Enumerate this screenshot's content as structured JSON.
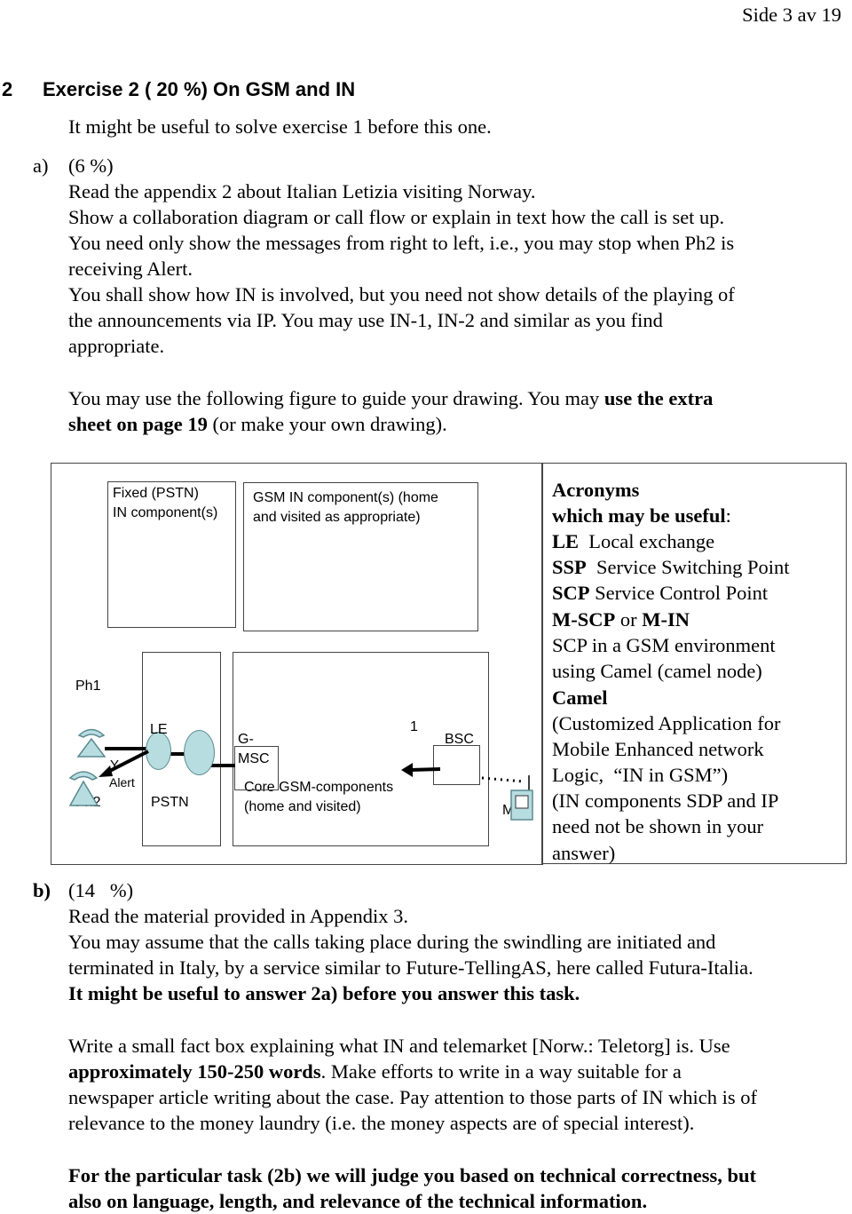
{
  "header": {
    "page": "Side 3 av 19"
  },
  "section": {
    "number": "2",
    "title": "Exercise 2 ( 20 %) On GSM and IN"
  },
  "intro": "It might be useful to solve exercise 1 before this one.",
  "a": {
    "label": "a)",
    "weight": "(6 %)",
    "lines": [
      "Read the appendix 2 about Italian Letizia visiting Norway.",
      "Show a collaboration diagram or call flow or explain in text how the call is set up.",
      "You need only show the messages from right to left, i.e., you may stop when Ph2 is",
      "receiving Alert.",
      "You shall show how IN is involved, but you need not show details of the playing of",
      "the announcements via IP. You may use IN-1, IN-2 and similar as you find",
      "appropriate."
    ],
    "guide1": "You may use the following figure to guide your drawing. You may ",
    "guide1_bold": "use the extra",
    "guide2_bold": "sheet on page 19",
    "guide2": " (or make your own drawing)."
  },
  "diagram": {
    "fixed_in": [
      "Fixed (PSTN)",
      "IN component(s)"
    ],
    "gsm_in": [
      "GSM IN component(s) (home",
      "and visited as appropriate)"
    ],
    "ph1": "Ph1",
    "ph2": "Ph2",
    "le": "LE",
    "y": "Y",
    "alert": "Alert",
    "pstn": "PSTN",
    "gmsc": [
      "G-",
      "MSC"
    ],
    "msg1": "1",
    "bsc": "BSC",
    "core": [
      "Core GSM-components",
      "(home and visited)"
    ],
    "ms1": "MS1",
    "node_color": "#b7dde0"
  },
  "acronyms": {
    "title": "Acronyms",
    "sub": "which may be useful",
    "items": [
      {
        "k": "LE",
        "v": "  Local exchange"
      },
      {
        "k": "SSP",
        "v": "  Service Switching Point"
      },
      {
        "k": "SCP",
        "v": " Service Control Point"
      }
    ],
    "mscp": "M-SCP",
    "or": " or ",
    "min": "M-IN",
    "l1": "SCP in a GSM environment",
    "l2": "using Camel (camel node)",
    "camel": "Camel",
    "l3": "(Customized Application for",
    "l4": "Mobile Enhanced network",
    "l5": "Logic,  “IN in GSM”)",
    "l6": "(IN components SDP and IP",
    "l7": "need not be shown in your",
    "l8": "answer)"
  },
  "b": {
    "label": "b)",
    "weight": "(14   %)",
    "l1": "Read the material provided in Appendix 3.",
    "l2": "You may assume that the calls taking place during the swindling are initiated and",
    "l3": "terminated in Italy, by a service similar to Future-TellingAS, here called Futura-Italia.",
    "l4_bold": "It might be useful to answer 2a) before you answer this task.",
    "l5": "Write a small fact box explaining what IN and telemarket [Norw.: Teletorg] is. Use",
    "l6_bold": "approximately 150-250 words",
    "l6": ". Make efforts to write in a way suitable for a",
    "l7": "newspaper article writing about the case. Pay attention to those parts of IN which is of",
    "l8": "relevance to the money laundry (i.e. the money aspects are of special interest).",
    "l9_bold": "For the particular task (2b) we will judge you based on technical correctness, but",
    "l10_bold": "also on language, length, and relevance of the technical information."
  }
}
